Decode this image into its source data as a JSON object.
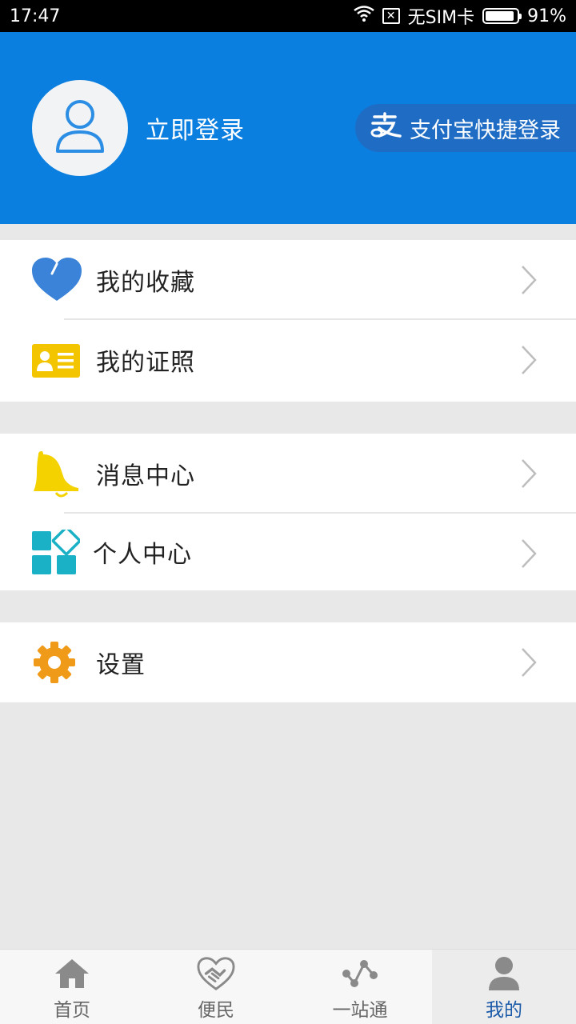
{
  "status_bar": {
    "time": "17:47",
    "sim_icon_label": "✕",
    "sim_text": "无SIM卡",
    "battery": "91%",
    "battery_level": 0.91
  },
  "header": {
    "login_text": "立即登录",
    "alipay_text": "支付宝快捷登录",
    "colors": {
      "background": "#0a7fe0",
      "alipay_bg": "#1f6cc4"
    }
  },
  "menu": {
    "groups": [
      {
        "items": [
          {
            "label": "我的收藏",
            "icon": "heart-icon"
          },
          {
            "label": "我的证照",
            "icon": "id-card-icon"
          }
        ]
      },
      {
        "items": [
          {
            "label": "消息中心",
            "icon": "bell-icon"
          },
          {
            "label": "个人中心",
            "icon": "apps-icon"
          }
        ]
      },
      {
        "items": [
          {
            "label": "设置",
            "icon": "gear-icon"
          }
        ]
      }
    ]
  },
  "tabbar": {
    "tabs": [
      {
        "label": "首页",
        "icon": "home-icon"
      },
      {
        "label": "便民",
        "icon": "handshake-icon"
      },
      {
        "label": "一站通",
        "icon": "network-icon"
      },
      {
        "label": "我的",
        "icon": "user-icon",
        "active": true
      }
    ]
  }
}
